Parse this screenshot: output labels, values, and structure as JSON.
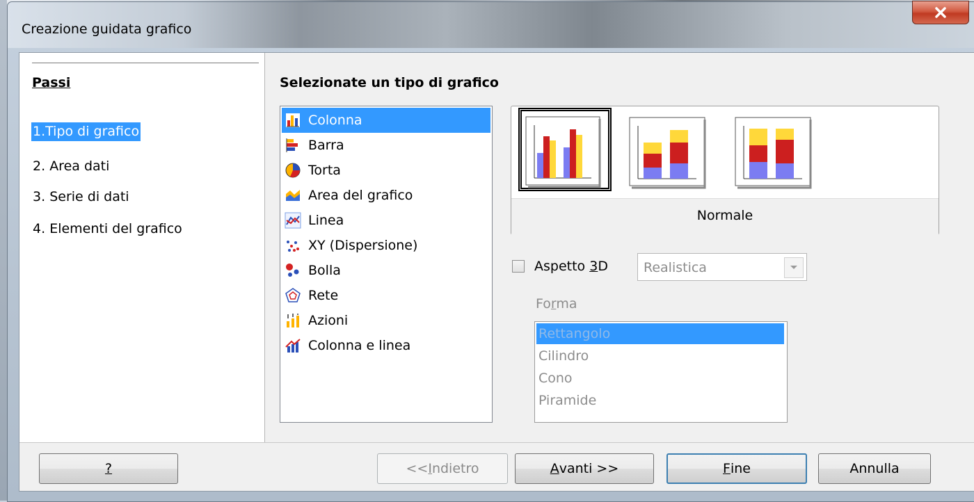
{
  "window": {
    "title": "Creazione guidata grafico"
  },
  "steps": {
    "title": "Passi",
    "items": [
      {
        "num": "1.",
        "label": "Tipo di grafico"
      },
      {
        "num": "2.",
        "label": "Area dati"
      },
      {
        "num": "3.",
        "label": "Serie di dati"
      },
      {
        "num": "4.",
        "label": "Elementi del grafico"
      }
    ]
  },
  "main": {
    "heading": "Selezionate un tipo di grafico",
    "chart_types": [
      {
        "label": "Colonna",
        "icon": "column-chart-icon"
      },
      {
        "label": "Barra",
        "icon": "bar-chart-icon"
      },
      {
        "label": "Torta",
        "icon": "pie-chart-icon"
      },
      {
        "label": "Area del grafico",
        "icon": "area-chart-icon"
      },
      {
        "label": "Linea",
        "icon": "line-chart-icon"
      },
      {
        "label": "XY (Dispersione)",
        "icon": "scatter-chart-icon"
      },
      {
        "label": "Bolla",
        "icon": "bubble-chart-icon"
      },
      {
        "label": "Rete",
        "icon": "net-chart-icon"
      },
      {
        "label": "Azioni",
        "icon": "stock-chart-icon"
      },
      {
        "label": "Colonna e linea",
        "icon": "column-line-chart-icon"
      }
    ],
    "variant_label": "Normale",
    "aspect_3d": {
      "label_pre": "Aspetto ",
      "label_key": "3",
      "label_post": "D",
      "checked": false
    },
    "aspect_combo": {
      "value": "Realistica"
    },
    "shape": {
      "label_pre": "Fo",
      "label_key": "r",
      "label_post": "ma",
      "items": [
        "Rettangolo",
        "Cilindro",
        "Cono",
        "Piramide"
      ]
    }
  },
  "buttons": {
    "help": "?",
    "back": {
      "pre": "<<",
      "key": "I",
      "post": "ndietro"
    },
    "next": {
      "key": "A",
      "post": "vanti >>"
    },
    "finish": {
      "key": "F",
      "post": "ine"
    },
    "cancel": "Annulla"
  },
  "colors": {
    "selection": "#3399ff",
    "series_blue": "#7b7cf2",
    "series_red": "#cc1f1f",
    "series_yellow": "#ffd83a",
    "close_red": "#c8452d"
  }
}
